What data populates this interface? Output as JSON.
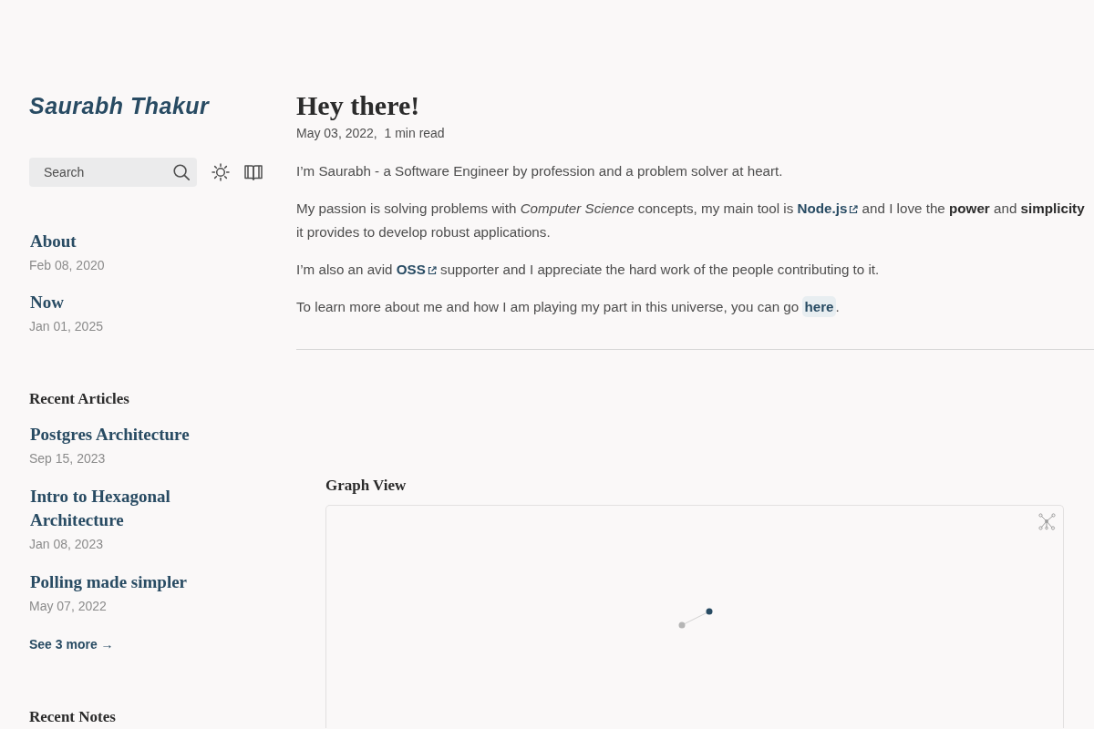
{
  "site_title": "Saurabh Thakur",
  "search": {
    "placeholder": "Search"
  },
  "pinned_pages": [
    {
      "title": "About",
      "date": "Feb 08, 2020"
    },
    {
      "title": "Now",
      "date": "Jan 01, 2025"
    }
  ],
  "recent_articles": {
    "heading": "Recent Articles",
    "items": [
      {
        "title": "Postgres Architecture",
        "date": "Sep 15, 2023"
      },
      {
        "title": "Intro to Hexagonal Architecture",
        "date": "Jan 08, 2023"
      },
      {
        "title": "Polling made simpler",
        "date": "May 07, 2022"
      }
    ],
    "more_link": "See 3 more →"
  },
  "recent_notes": {
    "heading": "Recent Notes"
  },
  "article": {
    "title": "Hey there!",
    "meta": "May 03, 2022,  1 min read",
    "paragraphs": [
      [
        {
          "kind": "text",
          "text": "I’m Saurabh - a Software Engineer by profession and a problem solver at heart."
        }
      ],
      [
        {
          "kind": "text",
          "text": "My passion is solving problems with *Computer Science* concepts, my main tool is "
        },
        {
          "kind": "external_link",
          "text": "Node.js"
        },
        {
          "kind": "text",
          "text": " and I love the **power** and **simplicity** it provides to develop robust applications."
        }
      ],
      [
        {
          "kind": "text",
          "text": "I’m also an avid "
        },
        {
          "kind": "external_link",
          "text": "OSS"
        },
        {
          "kind": "text",
          "text": " supporter and I appreciate the hard work of the people contributing to it."
        }
      ],
      [
        {
          "kind": "text",
          "text": "To learn more about me and how I am playing my part in this universe, you can go "
        },
        {
          "kind": "internal_link",
          "text": "here"
        },
        {
          "kind": "text",
          "text": "."
        }
      ]
    ]
  },
  "graph_view": {
    "heading": "Graph View"
  }
}
